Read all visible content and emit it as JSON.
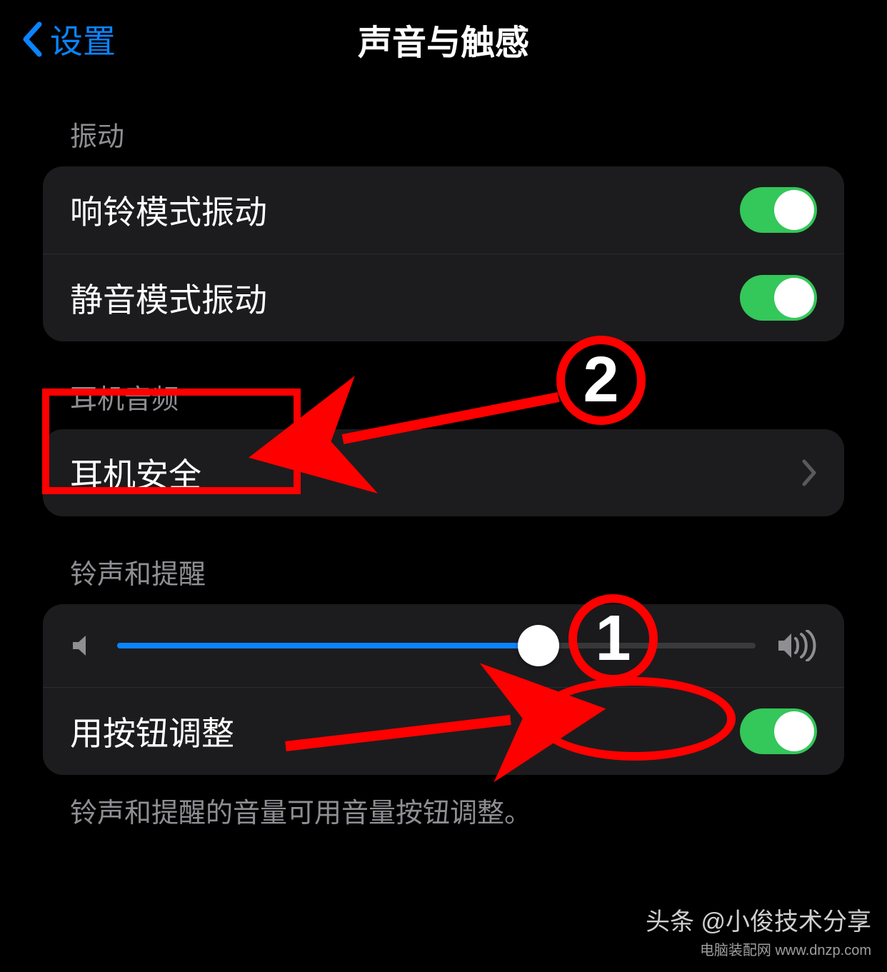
{
  "nav": {
    "back_label": "设置",
    "title": "声音与触感"
  },
  "sections": {
    "vibration_header": "振动",
    "vibrate_ring": "响铃模式振动",
    "vibrate_silent": "静音模式振动",
    "headphone_header": "耳机音频",
    "headphone_safety": "耳机安全",
    "ringer_header": "铃声和提醒",
    "change_with_buttons": "用按钮调整",
    "footer_note": "铃声和提醒的音量可用音量按钮调整。"
  },
  "slider": {
    "value_percent": 66
  },
  "toggles": {
    "vibrate_ring": true,
    "vibrate_silent": true,
    "change_with_buttons": true
  },
  "annotations": {
    "marker1": "1",
    "marker2": "2"
  },
  "watermark": {
    "main": "头条 @小俊技术分享",
    "sub": "电脑装配网  www.dnzp.com"
  },
  "colors": {
    "accent": "#0a84ff",
    "switch_on": "#34c759",
    "annotation": "#ff0000"
  }
}
